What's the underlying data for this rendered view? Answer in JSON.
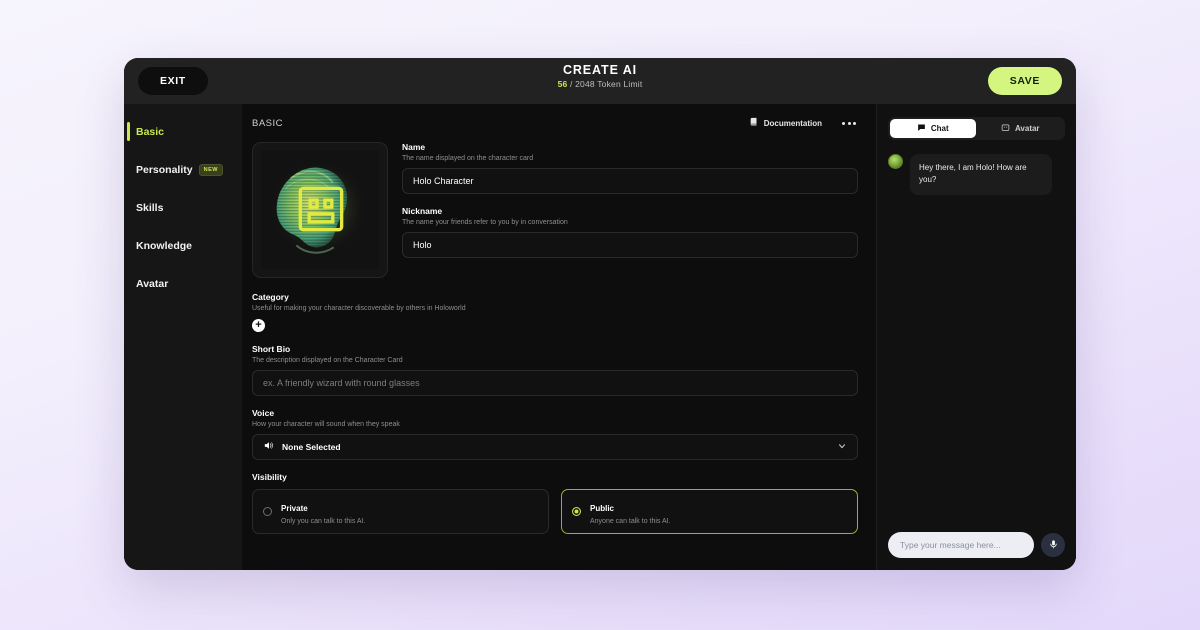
{
  "topbar": {
    "exit_label": "EXIT",
    "title": "CREATE AI",
    "token_count": "56",
    "token_suffix": "/ 2048 Token Limit",
    "save_label": "SAVE"
  },
  "sidebar": {
    "items": [
      {
        "label": "Basic",
        "active": true
      },
      {
        "label": "Personality",
        "badge": "NEW"
      },
      {
        "label": "Skills"
      },
      {
        "label": "Knowledge"
      },
      {
        "label": "Avatar"
      }
    ]
  },
  "main": {
    "section_kicker": "BASIC",
    "documentation_label": "Documentation",
    "name": {
      "label": "Name",
      "help": "The name displayed on the character card",
      "value": "Holo Character"
    },
    "nickname": {
      "label": "Nickname",
      "help": "The name your friends refer to you by in conversation",
      "value": "Holo"
    },
    "category": {
      "label": "Category",
      "help": "Useful for making your character discoverable by others in Holoworld",
      "add_symbol": "+"
    },
    "short_bio": {
      "label": "Short Bio",
      "help": "The description displayed on the Character Card",
      "placeholder": "ex. A friendly wizard with round glasses",
      "value": ""
    },
    "voice": {
      "label": "Voice",
      "help": "How your character will sound when they speak",
      "selected": "None Selected"
    },
    "visibility": {
      "label": "Visibility",
      "options": [
        {
          "title": "Private",
          "subtitle": "Only you can talk to this AI.",
          "selected": false
        },
        {
          "title": "Public",
          "subtitle": "Anyone can talk to this AI.",
          "selected": true
        }
      ]
    }
  },
  "chat": {
    "tabs": [
      {
        "label": "Chat",
        "active": true
      },
      {
        "label": "Avatar",
        "active": false
      }
    ],
    "messages": [
      {
        "sender": "assistant",
        "text": "Hey there, I am Holo! How are you?"
      }
    ],
    "composer_placeholder": "Type your message here...",
    "composer_value": ""
  },
  "colors": {
    "accent_green": "#c8e84f",
    "save_button": "#d4f57f",
    "window_bg": "#0d0d0d",
    "page_bg": "#eee9fb"
  }
}
